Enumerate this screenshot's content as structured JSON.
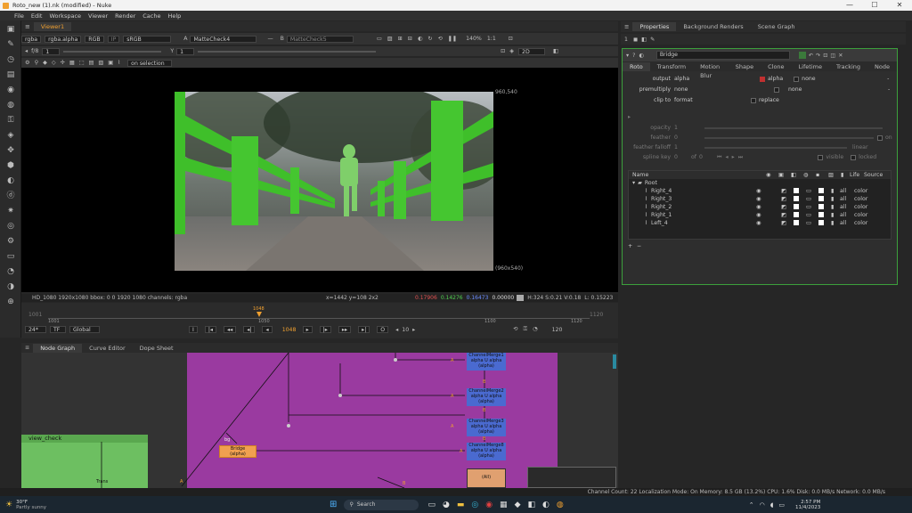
{
  "window": {
    "title": "Roto_new (1).nk (modified) - Nuke",
    "min": "—",
    "max": "☐",
    "close": "✕"
  },
  "menu": [
    "File",
    "Edit",
    "Workspace",
    "Viewer",
    "Render",
    "Cache",
    "Help"
  ],
  "viewer": {
    "tab": "Viewer1",
    "controls": {
      "layer": "rgba",
      "channel": "rgba.alpha",
      "colorspace_label": "RGB",
      "ip": "IP",
      "lut": "sRGB",
      "a_label": "A",
      "a_input": "MatteCheck4",
      "b_label": "B",
      "b_input": "MatteCheck5",
      "zoom": "140%",
      "ratio": "1:1",
      "fstop": "f/8",
      "exposure": "1",
      "gamma": "Y",
      "gamma_val": "1",
      "view": "2D",
      "mode": "on selection"
    },
    "format_top": "960,540",
    "format_bottom": "(960x540)",
    "info": {
      "format": "HD_1080 1920x1080  bbox: 0 0 1920 1080 channels: rgba",
      "coords": "x=1442 y=108 2x2",
      "r": "0.17906",
      "g": "0.14276",
      "b": "0.16473",
      "a": "0.00000",
      "hsv": "H:324 S:0.21 V:0.18",
      "l": "L: 0.15223"
    }
  },
  "timeline": {
    "start": "1001",
    "end": "1120",
    "current": "1048",
    "ticks": [
      "1001",
      "1050",
      "1100",
      "1120"
    ],
    "fps": "24*",
    "tf": "TF",
    "global": "Global",
    "frame": "1048",
    "step": "10",
    "end_frame": "120"
  },
  "nodegraph": {
    "tabs": [
      "Node Graph",
      "Curve Editor",
      "Dope Sheet"
    ],
    "backdrop": "view_check",
    "backdrop_footer": "Trans",
    "nodes": [
      {
        "label": "ChannelMerge1",
        "sub": "alpha U alpha",
        "sub2": "(alpha)"
      },
      {
        "label": "ChannelMerge2",
        "sub": "alpha U alpha",
        "sub2": "(alpha)"
      },
      {
        "label": "ChannelMerge3",
        "sub": "alpha U alpha",
        "sub2": "(alpha)"
      },
      {
        "label": "ChannelMerge8",
        "sub": "alpha U alpha",
        "sub2": "(alpha)"
      }
    ],
    "bridge": {
      "label": "Bridge",
      "sub": "(alpha)",
      "tag": "bg"
    },
    "pins": [
      "A",
      "A",
      "A",
      "A",
      "B",
      "B",
      "B",
      "A",
      "B"
    ],
    "merge_label": "(All)"
  },
  "properties": {
    "tabs": [
      "Properties",
      "Background Renders",
      "Scene Graph"
    ],
    "node_name": "Bridge",
    "subtabs": [
      "Roto",
      "Transform",
      "Motion Blur",
      "Shape",
      "Clone",
      "Lifetime",
      "Tracking",
      "Node"
    ],
    "output_label": "output",
    "output_val": "alpha",
    "output_chk": "alpha",
    "output_none": "none",
    "premult_label": "premultiply",
    "premult_val": "none",
    "premult_none": "none",
    "clip_label": "clip to",
    "clip_val": "format",
    "replace": "replace",
    "opacity_label": "opacity",
    "opacity_val": "1",
    "feather_label": "feather",
    "feather_val": "0",
    "feather_on": "on",
    "falloff_label": "feather falloff",
    "falloff_val": "1",
    "falloff_type": "linear",
    "spline_label": "spline key",
    "spline_val": "0",
    "spline_of": "of",
    "spline_total": "0",
    "visible": "visible",
    "locked": "locked",
    "table_headers": [
      "Name",
      "Life",
      "Source"
    ],
    "root": "Root",
    "layers": [
      {
        "name": "Right_4",
        "life": "all",
        "source": "color"
      },
      {
        "name": "Right_3",
        "life": "all",
        "source": "color"
      },
      {
        "name": "Right_2",
        "life": "all",
        "source": "color"
      },
      {
        "name": "Right_1",
        "life": "all",
        "source": "color"
      },
      {
        "name": "Left_4",
        "life": "all",
        "source": "color"
      }
    ]
  },
  "statusbar": "Channel Count: 22  Localization Mode: On  Memory: 8.5 GB (13.2%)  CPU: 1.6%  Disk: 0.0 MB/s  Network: 0.0 MB/s",
  "taskbar": {
    "weather_temp": "30°F",
    "weather_text": "Partly sunny",
    "search": "Search",
    "time": "2:57 PM",
    "date": "11/4/2023"
  }
}
